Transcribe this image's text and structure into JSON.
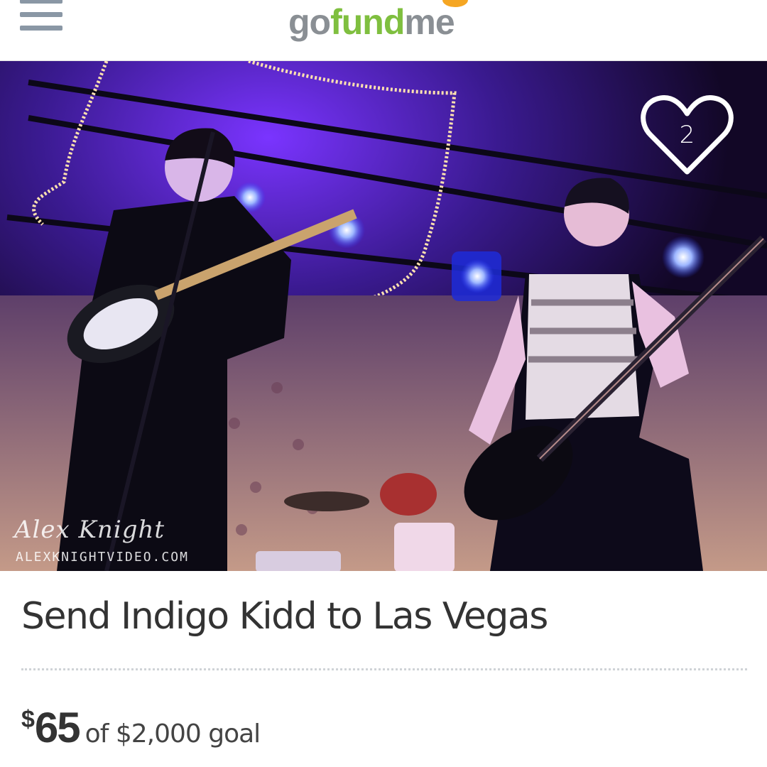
{
  "header": {
    "logo": {
      "part1": "go",
      "part2": "fund",
      "part3": "me",
      "alt": "gofundme"
    },
    "menu_icon": "hamburger-menu-icon"
  },
  "hero": {
    "like_count": "2",
    "like_icon": "heart-icon",
    "watermark_signature": "Alex Knight",
    "watermark_url": "ALEXKNIGHTVIDEO.COM"
  },
  "campaign": {
    "title": "Send Indigo Kidd to Las Vegas",
    "currency_symbol": "$",
    "raised": "65",
    "goal_text": "of $2,000 goal"
  },
  "colors": {
    "brand_green": "#7fbf3f",
    "logo_gray": "#8a8f94",
    "paw_orange": "#f5a623",
    "menu_gray": "#8a97a5",
    "text_dark": "#333333"
  }
}
